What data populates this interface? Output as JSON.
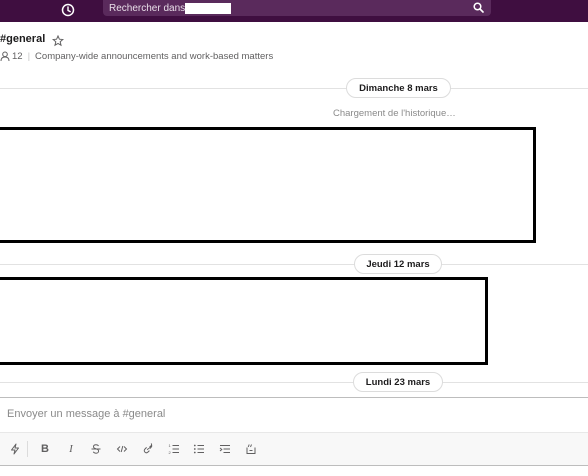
{
  "search": {
    "placeholder": "Rechercher dans"
  },
  "channel": {
    "title": "#general",
    "member_count": "12",
    "topic": "Company-wide announcements and work-based matters"
  },
  "messages": {
    "day_1": "Dimanche 8 mars",
    "loading": "Chargement de l'historique…",
    "day_2": "Jeudi 12 mars",
    "day_3": "Lundi 23 mars"
  },
  "composer": {
    "placeholder": "Envoyer un message à #general"
  },
  "icons": {
    "history": "clock-icon",
    "search": "magnifier-icon",
    "favorite": "star-icon",
    "members": "person-icon",
    "shortcuts": "lightning-icon",
    "bold": "bold-icon",
    "italic": "italic-icon",
    "strike": "strikethrough-icon",
    "code": "code-icon",
    "link": "link-icon",
    "ordered_list": "numbered-list-icon",
    "bullet_list": "bulleted-list-icon",
    "indent": "indent-list-icon",
    "code_block": "code-block-icon"
  },
  "colors": {
    "topbar": "#3f0e40",
    "search_field": "#5a2a5c",
    "text": "#1d1c1d",
    "muted_text": "#616061"
  }
}
